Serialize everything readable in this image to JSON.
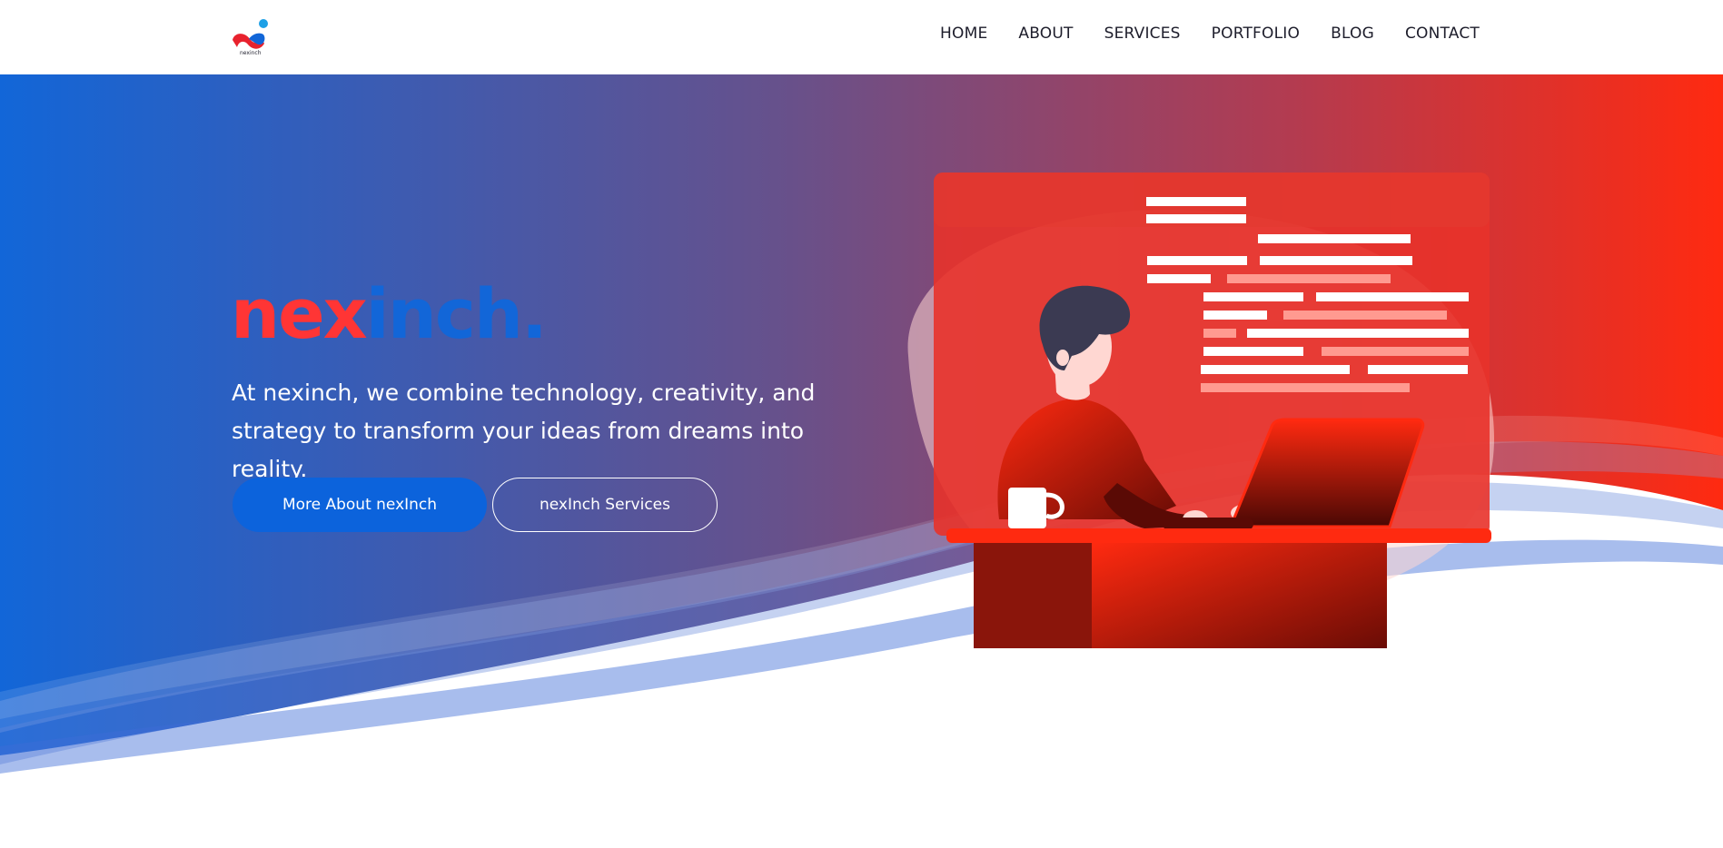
{
  "header": {
    "logo_alt": "nexinch logo",
    "logo_text": "nexinch",
    "nav": [
      "HOME",
      "ABOUT",
      "SERVICES",
      "PORTFOLIO",
      "BLOG",
      "CONTACT"
    ]
  },
  "hero": {
    "brand_part1": "nex",
    "brand_part2": "inch.",
    "tagline_line1": "At nexinch, we combine technology, creativity, and",
    "tagline_line2": "strategy to transform your ideas from dreams into reality.",
    "primary_button": "More About nexInch",
    "secondary_button": "nexInch Services"
  },
  "colors": {
    "gradient_start": "#1266d8",
    "gradient_end": "#ff2a10",
    "brand_red": "#ff3535",
    "brand_blue": "#1266d8",
    "button_blue": "#0c63dc"
  },
  "icons": [
    "logo-icon",
    "person-illustration",
    "laptop-icon",
    "coffee-mug-icon",
    "code-screen-illustration",
    "desk-illustration"
  ]
}
